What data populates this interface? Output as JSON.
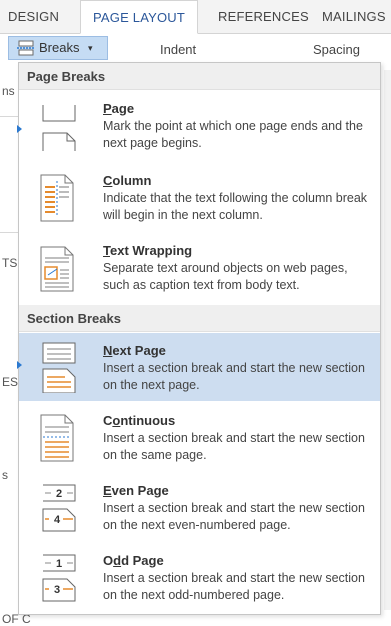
{
  "ribbon": {
    "tabs": [
      {
        "label": "DESIGN"
      },
      {
        "label": "PAGE LAYOUT"
      },
      {
        "label": "REFERENCES"
      },
      {
        "label": "MAILINGS"
      }
    ],
    "breaks_label": "Breaks",
    "indent_label": "Indent",
    "spacing_label": "Spacing"
  },
  "background": {
    "left_fragments": [
      "ns",
      "TS",
      "ES",
      "s",
      "OF C"
    ]
  },
  "menu": {
    "page_breaks_header": "Page Breaks",
    "section_breaks_header": "Section Breaks",
    "items": [
      {
        "title_pre": "",
        "title_u": "P",
        "title_post": "age",
        "desc": "Mark the point at which one page ends and the next page begins.",
        "icon": "page-break-icon"
      },
      {
        "title_pre": "",
        "title_u": "C",
        "title_post": "olumn",
        "desc": "Indicate that the text following the column break will begin in the next column.",
        "icon": "column-break-icon"
      },
      {
        "title_pre": "",
        "title_u": "T",
        "title_post": "ext Wrapping",
        "desc": "Separate text around objects on web pages, such as caption text from body text.",
        "icon": "text-wrapping-icon"
      },
      {
        "title_pre": "",
        "title_u": "N",
        "title_post": "ext Page",
        "desc": "Insert a section break and start the new section on the next page.",
        "icon": "next-page-icon"
      },
      {
        "title_pre": "C",
        "title_u": "o",
        "title_post": "ntinuous",
        "desc": "Insert a section break and start the new section on the same page.",
        "icon": "continuous-icon"
      },
      {
        "title_pre": "",
        "title_u": "E",
        "title_post": "ven Page",
        "desc": "Insert a section break and start the new section on the next even-numbered page.",
        "icon": "even-page-icon"
      },
      {
        "title_pre": "O",
        "title_u": "d",
        "title_post": "d Page",
        "desc": "Insert a section break and start the new section on the next odd-numbered page.",
        "icon": "odd-page-icon"
      }
    ],
    "even_icon_numbers": [
      "2",
      "4"
    ],
    "odd_icon_numbers": [
      "1",
      "3"
    ]
  },
  "colors": {
    "accent": "#2b579a",
    "highlight": "#cdddf0",
    "button_active": "#c5dcf4"
  }
}
